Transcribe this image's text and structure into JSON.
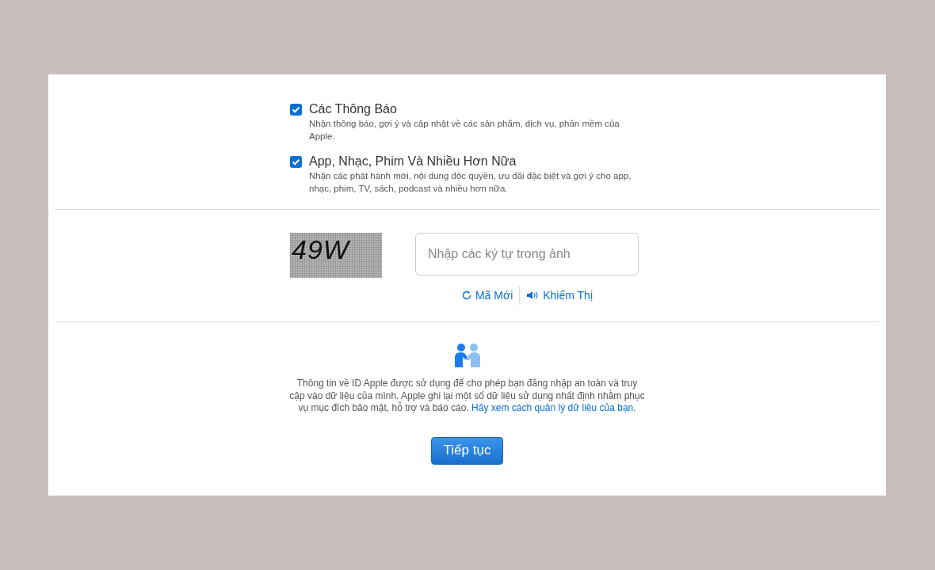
{
  "options": [
    {
      "title": "Các Thông Báo",
      "description": "Nhận thông báo, gợi ý và cập nhật về các sản phẩm, dịch vụ, phần mềm của Apple.",
      "checked": true
    },
    {
      "title": "App, Nhạc, Phim Và Nhiều Hơn Nữa",
      "description": "Nhận các phát hành mới, nội dung độc quyền, ưu đãi đặc biệt và gợi ý cho app, nhạc, phim, TV, sách, podcast và nhiều hơn nữa.",
      "checked": true
    }
  ],
  "captcha": {
    "text": "49W",
    "input": {
      "placeholder": "Nhập các ký tự trong ảnh"
    },
    "new_code": "Mã Mới",
    "audio": "Khiếm Thị"
  },
  "privacy": {
    "text": "Thông tin về ID Apple được sử dụng để cho phép bạn đăng nhập an toàn và truy cập vào dữ liệu của mình. Apple ghi lại một số dữ liệu sử dụng nhất định nhằm phục vụ mục đích bảo mật, hỗ trợ và báo cáo.",
    "link": "Hãy xem cách quản lý dữ liệu của bạn."
  },
  "continue_button": "Tiếp tục"
}
